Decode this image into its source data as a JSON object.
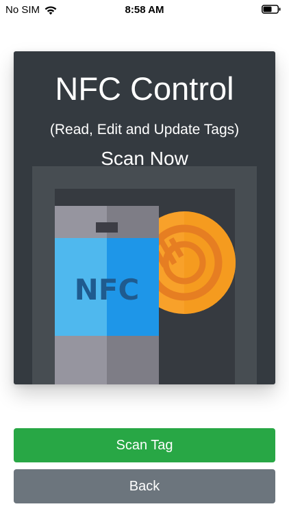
{
  "status_bar": {
    "carrier": "No SIM",
    "time": "8:58 AM",
    "battery_level": 0.6,
    "icons": [
      "wifi-icon",
      "battery-icon"
    ]
  },
  "card": {
    "title": "NFC Control",
    "subtitle": "(Read, Edit and Update Tags)",
    "scan_prompt": "Scan Now",
    "illustration": {
      "name": "nfc-phone-and-tag-illustration",
      "phone_label": "NFC"
    }
  },
  "buttons": {
    "scan_tag": "Scan Tag",
    "back": "Back"
  },
  "colors": {
    "card_bg": "#343a40",
    "scan_button": "#28a745",
    "back_button": "#6c757d",
    "phone_screen": "#4fb8ee",
    "tag_orange": "#f8a12a"
  }
}
